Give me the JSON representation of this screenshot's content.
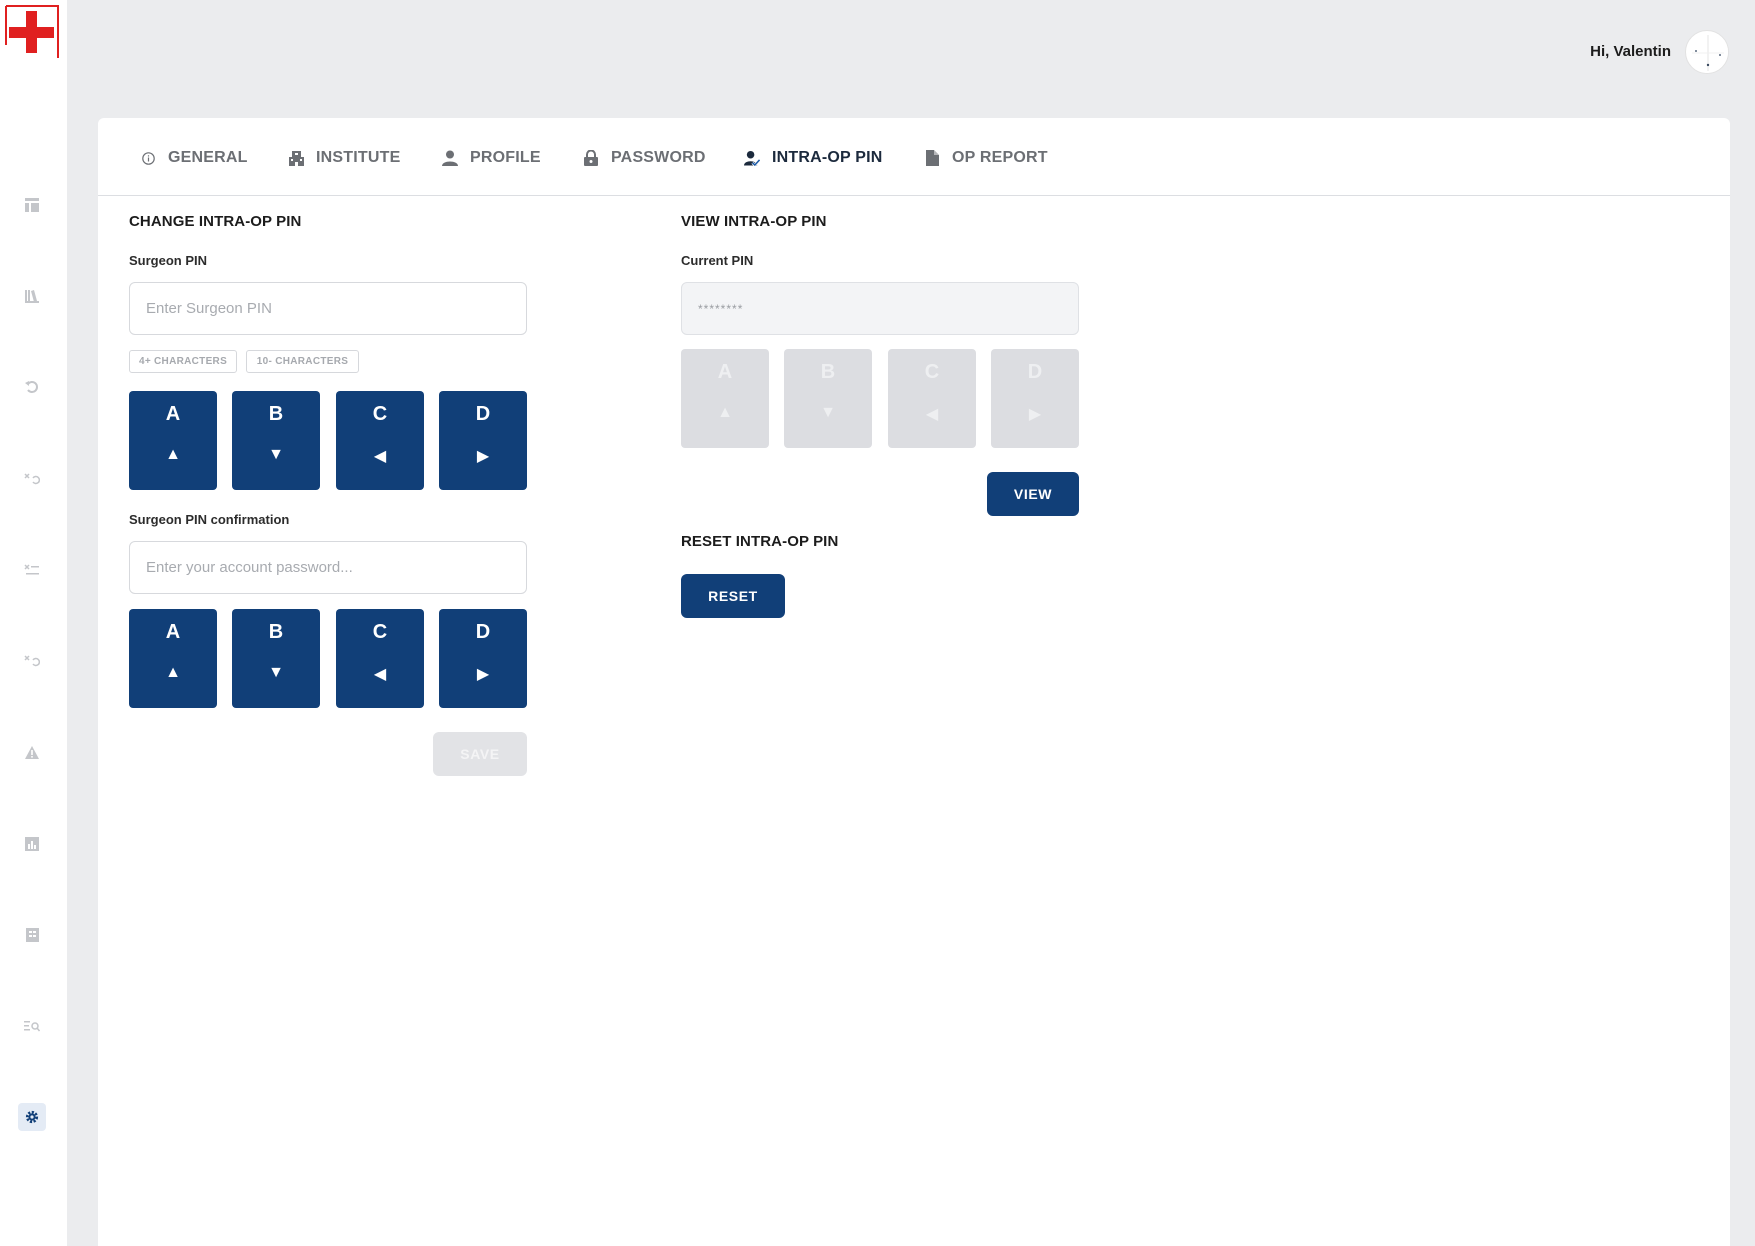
{
  "header": {
    "greeting": "Hi, Valentin"
  },
  "tabs": [
    {
      "label": "GENERAL",
      "icon": "info-icon"
    },
    {
      "label": "INSTITUTE",
      "icon": "building-icon"
    },
    {
      "label": "PROFILE",
      "icon": "person-icon"
    },
    {
      "label": "PASSWORD",
      "icon": "lock-icon"
    },
    {
      "label": "INTRA-OP PIN",
      "icon": "user-check-icon",
      "active": true
    },
    {
      "label": "OP REPORT",
      "icon": "document-icon"
    }
  ],
  "change_pin": {
    "title": "CHANGE INTRA-OP PIN",
    "pin_label": "Surgeon PIN",
    "pin_placeholder": "Enter Surgeon PIN",
    "rules": [
      "4+ CHARACTERS",
      "10- CHARACTERS"
    ],
    "keys": [
      {
        "letter": "A",
        "arrow": "▲"
      },
      {
        "letter": "B",
        "arrow": "▼"
      },
      {
        "letter": "C",
        "arrow": "◀"
      },
      {
        "letter": "D",
        "arrow": "▶"
      }
    ],
    "confirm_label": "Surgeon PIN confirmation",
    "confirm_placeholder": "Enter your account password...",
    "save_label": "SAVE"
  },
  "view_pin": {
    "title": "VIEW INTRA-OP PIN",
    "current_label": "Current PIN",
    "current_value": "********",
    "keys": [
      {
        "letter": "A",
        "arrow": "▲"
      },
      {
        "letter": "B",
        "arrow": "▼"
      },
      {
        "letter": "C",
        "arrow": "◀"
      },
      {
        "letter": "D",
        "arrow": "▶"
      }
    ],
    "view_label": "VIEW"
  },
  "reset_pin": {
    "title": "RESET INTRA-OP PIN",
    "reset_label": "RESET"
  },
  "colors": {
    "primary": "#113f78",
    "logo_red": "#e02020",
    "background": "#ebecee"
  }
}
